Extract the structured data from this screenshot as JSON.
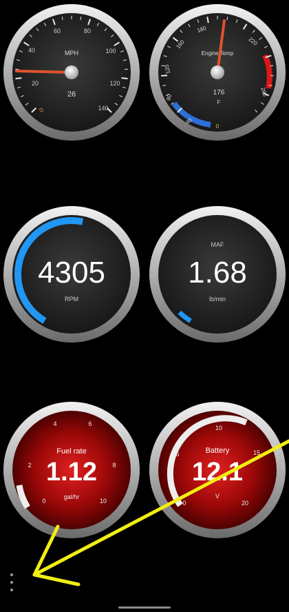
{
  "gauges": {
    "speed": {
      "label": "MPH",
      "value": "26",
      "min": 0,
      "max": 140,
      "ticks": [
        "0",
        "20",
        "40",
        "60",
        "80",
        "100",
        "120",
        "140"
      ]
    },
    "temp": {
      "label": "Engine Temp",
      "value": "176",
      "unit": "F",
      "min": 0,
      "max": 260,
      "ticks": [
        "0",
        "40",
        "80",
        "120",
        "160",
        "180",
        "220",
        "260"
      ],
      "cold_color": "#2d6fd6",
      "hot_color": "#d91818"
    },
    "rpm": {
      "value": "4305",
      "label": "RPM",
      "fraction": 0.54,
      "arc_color": "#2196f3"
    },
    "maf": {
      "label": "MAF",
      "value": "1.68",
      "unit": "lb/min",
      "fraction": 0.05,
      "arc_color": "#2196f3"
    },
    "fuel": {
      "label": "Fuel rate",
      "value": "1.12",
      "unit": "gal/hr",
      "ticks": [
        "0",
        "2",
        "4",
        "6",
        "8",
        "10"
      ],
      "face_color": "#7a0000"
    },
    "battery": {
      "label": "Battery",
      "value": "12.1",
      "unit": "V",
      "ticks": [
        "0",
        "5",
        "10",
        "15",
        "20"
      ],
      "face_color": "#7a0000"
    }
  },
  "menu": {
    "icon": "more-vert-icon"
  },
  "annotation": {
    "color": "#f2ee14"
  }
}
